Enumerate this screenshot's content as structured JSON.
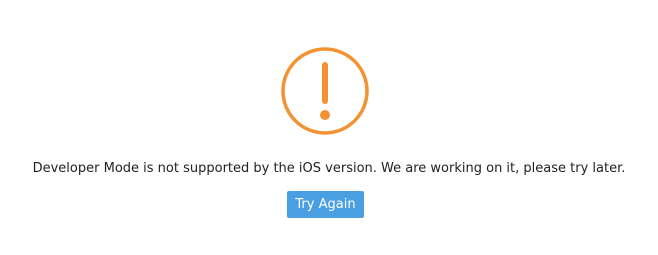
{
  "dialog": {
    "icon": "exclamation-circle-icon",
    "message": "Developer Mode is not supported by the iOS version. We are working on it, please try later.",
    "retry_label": "Try Again"
  },
  "colors": {
    "icon": "#f39233",
    "button": "#4a9fe3",
    "button_text": "#ffffff",
    "text": "#222222"
  }
}
